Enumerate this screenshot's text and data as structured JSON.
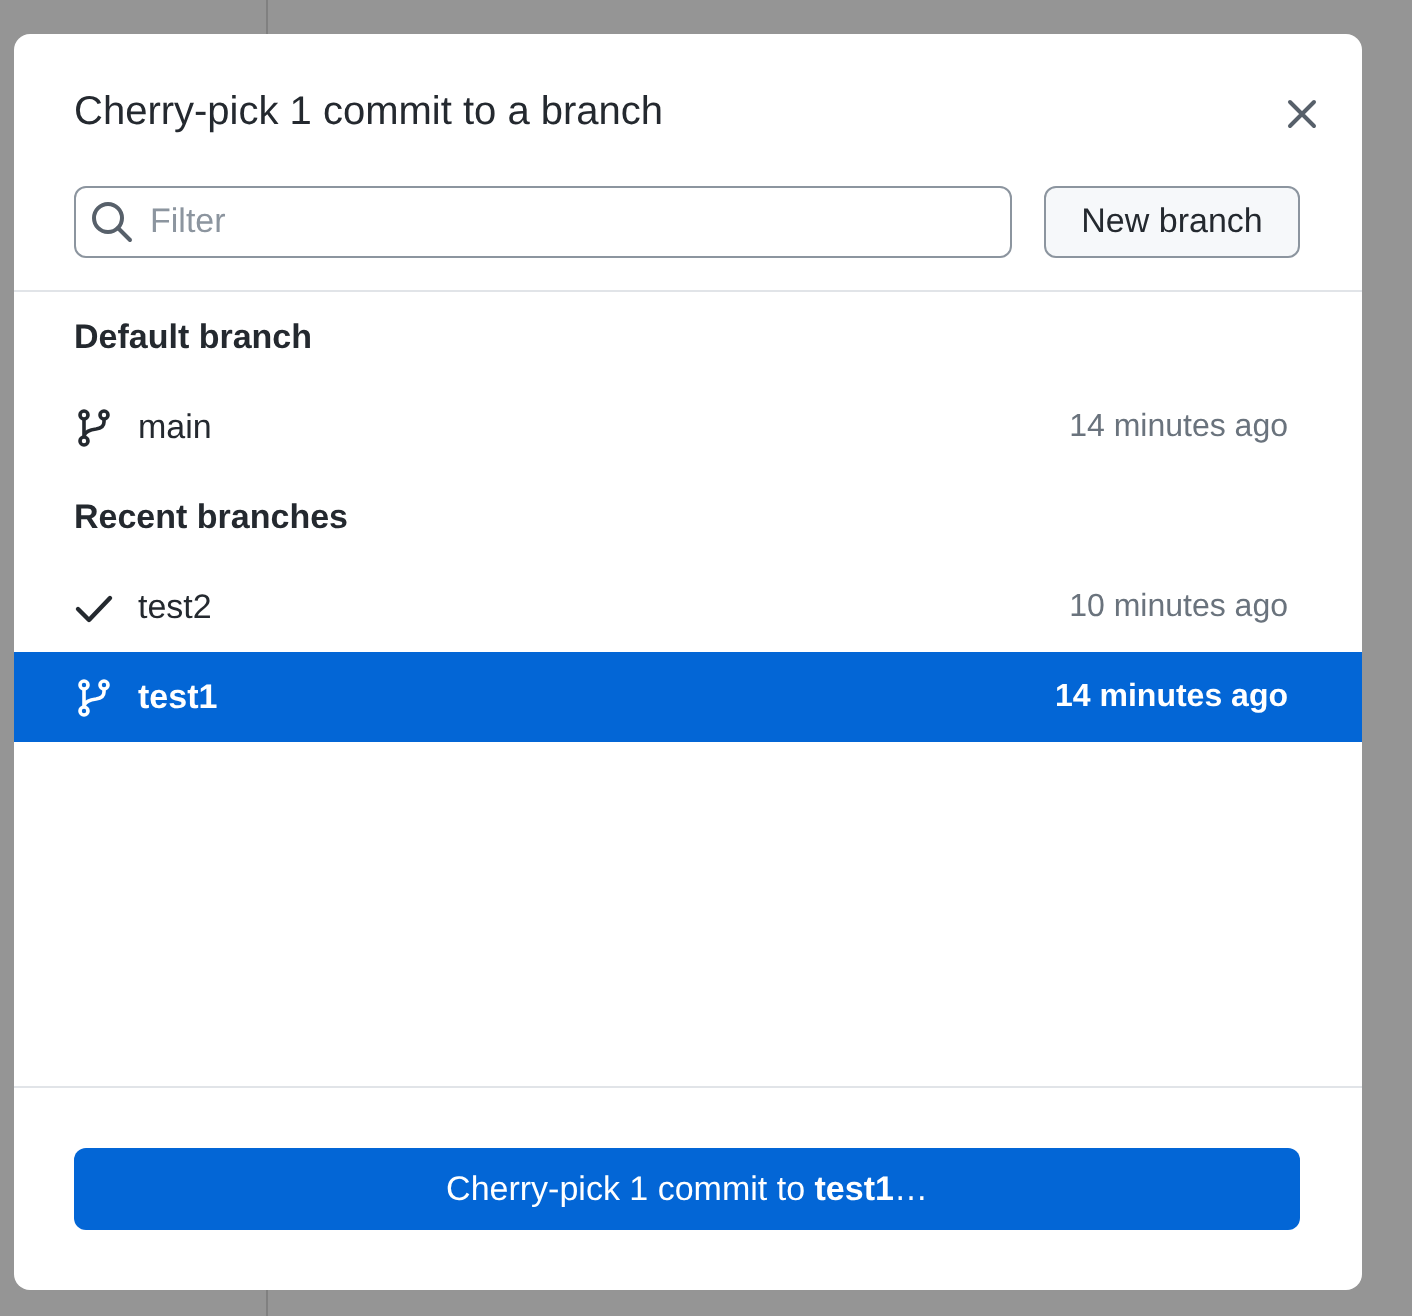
{
  "dialog": {
    "title": "Cherry-pick 1 commit to a branch"
  },
  "filter": {
    "placeholder": "Filter"
  },
  "new_branch_button": "New branch",
  "sections": [
    {
      "heading": "Default branch",
      "branches": [
        {
          "name": "main",
          "time": "14 minutes ago",
          "current": false,
          "selected": false
        }
      ]
    },
    {
      "heading": "Recent branches",
      "branches": [
        {
          "name": "test2",
          "time": "10 minutes ago",
          "current": true,
          "selected": false
        },
        {
          "name": "test1",
          "time": "14 minutes ago",
          "current": false,
          "selected": true
        }
      ]
    }
  ],
  "submit_button": "Cherry-pick 1 commit to **test1**…"
}
